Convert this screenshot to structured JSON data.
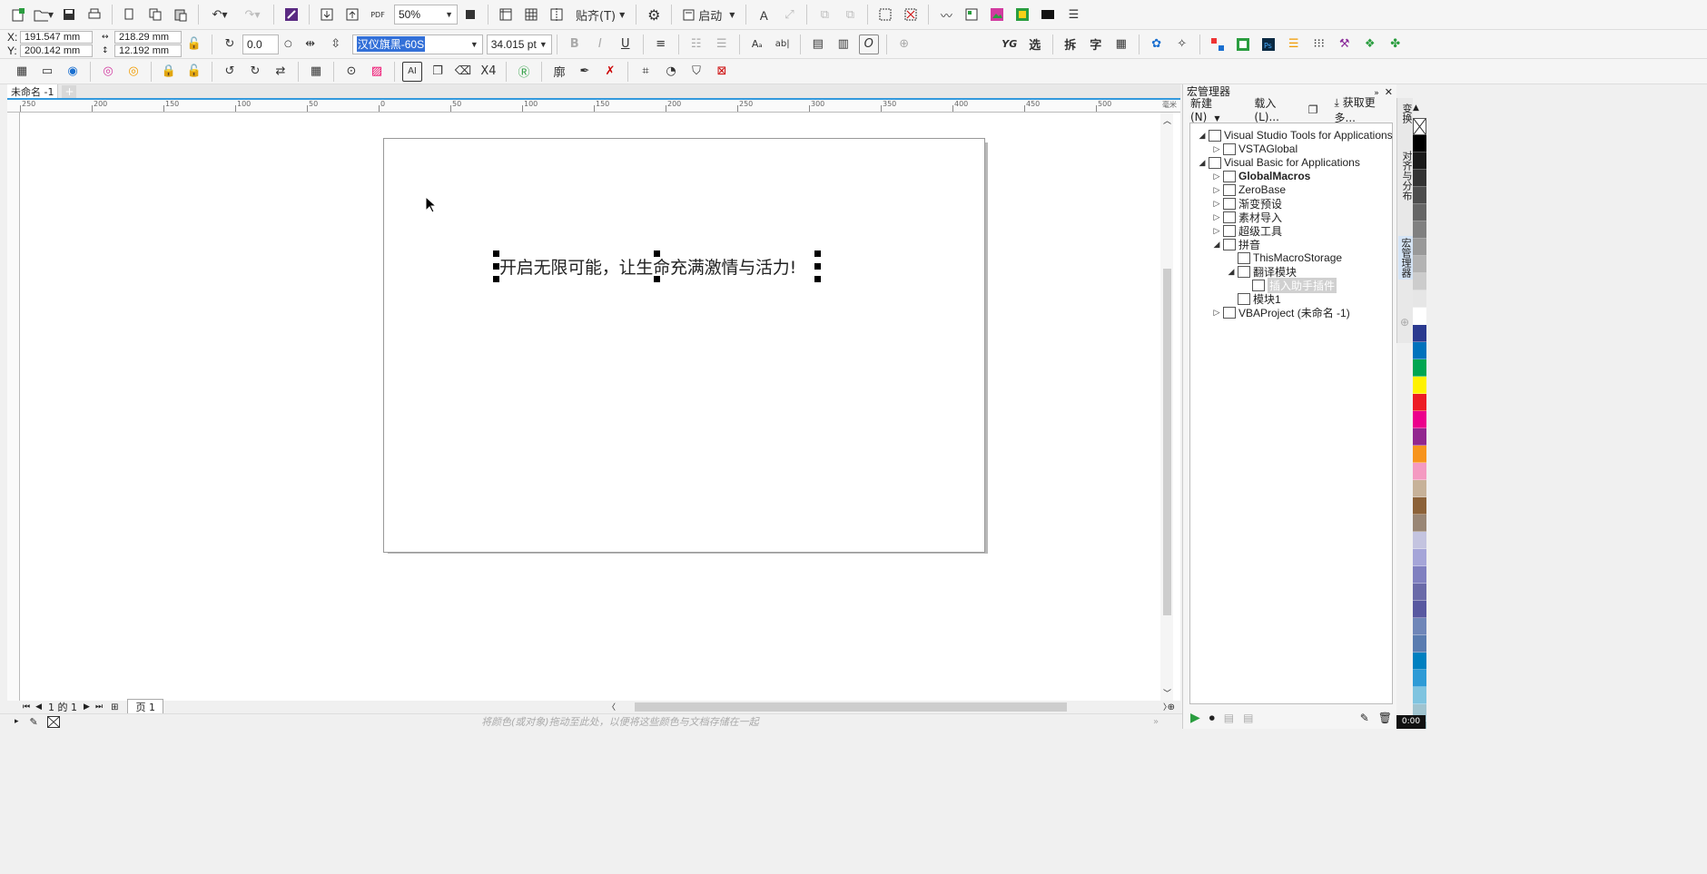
{
  "toolbar1": {
    "zoom_value": "50%",
    "snap_label": "贴齐(T)",
    "launch_label": "启动",
    "pdf_label": "PDF"
  },
  "propbar": {
    "x_label": "X:",
    "y_label": "Y:",
    "x_value": "191.547 mm",
    "y_value": "200.142 mm",
    "w_value": "218.29 mm",
    "h_value": "12.192 mm",
    "rotation_value": "0.0",
    "font_name": "汉仪旗黑-60S",
    "font_size": "34.015 pt",
    "bold": "B",
    "italic": "I",
    "underline": "U",
    "yg": "YG",
    "btn_select": "选",
    "btn_split": "拆",
    "btn_char": "字"
  },
  "toolbar3": {
    "x4_label": "X4",
    "outline_label": "廓"
  },
  "document": {
    "tab_title": "未命名 -1",
    "canvas_text": "开启无限可能，让生命充满激情与活力!"
  },
  "ruler": {
    "h_ticks": [
      "250",
      "200",
      "150",
      "100",
      "50",
      "0",
      "50",
      "100",
      "150",
      "200",
      "250",
      "300",
      "350",
      "400",
      "450",
      "500"
    ],
    "unit": "毫米"
  },
  "pagebar": {
    "counter": "1 的 1",
    "page_tab": "页 1"
  },
  "statusbar": {
    "hint": "将颜色(或对象)拖动至此处，以便将这些颜色与文档存储在一起"
  },
  "macro_panel": {
    "title": "宏管理器",
    "new_label": "新建(N)",
    "load_label": "载入(L)...",
    "more_label": "获取更多...",
    "tree": [
      {
        "label": "Visual Studio Tools for Applications",
        "bold": false
      },
      {
        "label": "VSTAGlobal",
        "bold": false
      },
      {
        "label": "Visual Basic for Applications",
        "bold": false
      },
      {
        "label": "GlobalMacros",
        "bold": true
      },
      {
        "label": "ZeroBase",
        "bold": false
      },
      {
        "label": "渐变预设",
        "bold": false
      },
      {
        "label": "素材导入",
        "bold": false
      },
      {
        "label": "超级工具",
        "bold": false
      },
      {
        "label": "拼音",
        "bold": false
      },
      {
        "label": "ThisMacroStorage",
        "bold": false
      },
      {
        "label": "翻译模块",
        "bold": false
      },
      {
        "label": "插入助手插件",
        "bold": false
      },
      {
        "label": "模块1",
        "bold": false
      },
      {
        "label": "VBAProject (未命名 -1)",
        "bold": false
      }
    ]
  },
  "side_tabs": [
    "变换",
    "对齐与分布",
    "宏管理器"
  ],
  "palette": [
    "#ffffff",
    "#000000",
    "#1a1a1a",
    "#333333",
    "#4d4d4d",
    "#666666",
    "#808080",
    "#999999",
    "#b3b3b3",
    "#cccccc",
    "#e6e6e6",
    "#ffffff",
    "#2b3a8f",
    "#0072bc",
    "#00a651",
    "#fff200",
    "#ed1c24",
    "#ec008c",
    "#92278f",
    "#f7941d",
    "#f49ac1",
    "#c7b299",
    "#8c6239",
    "#998675",
    "#c4c4e0",
    "#a5a5d8",
    "#8080c0",
    "#6a6aa8",
    "#5858a0",
    "#6f86b8",
    "#5a7cb0",
    "#0080c0",
    "#2e9bd6",
    "#7fc4e0",
    "#a0c4d0",
    "#8ab0b8",
    "#6a9aa0",
    "#5e8a84",
    "#4a7870",
    "#3e8e7e",
    "#52a39a",
    "#65b3a8",
    "#79c2b6",
    "#8dd0c4",
    "#a1ddd2",
    "#3aa6a0"
  ],
  "timer": "0:00"
}
